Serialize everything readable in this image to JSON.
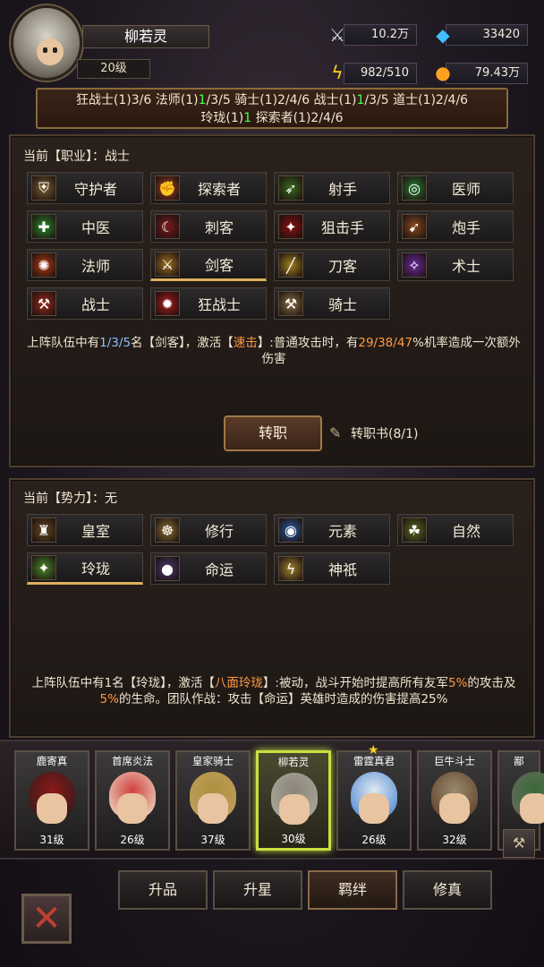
{
  "player": {
    "name": "柳若灵",
    "level": "20级"
  },
  "resources": {
    "power": "10.2万",
    "gems": "33420",
    "energy": "982/510",
    "gold": "79.43万"
  },
  "bonus": {
    "line1": [
      {
        "t": "狂战士(1)3/6 法师(1)"
      },
      {
        "t": "1",
        "g": true
      },
      {
        "t": "/3/5 骑士(1)2/4/6 战士(1)"
      },
      {
        "t": "1",
        "g": true
      },
      {
        "t": "/3/5 道士(1)2/4/6"
      }
    ],
    "line2": [
      {
        "t": "玲珑(1)"
      },
      {
        "t": "1",
        "g": true
      },
      {
        "t": " 探索者(1)2/4/6"
      }
    ]
  },
  "profession": {
    "header": "当前【职业】：战士",
    "items": [
      {
        "label": "守护者",
        "icon": "shield-icon",
        "color": "#7a6030",
        "glyph": "⛨"
      },
      {
        "label": "探索者",
        "icon": "fist-icon",
        "color": "#a04020",
        "glyph": "✊"
      },
      {
        "label": "射手",
        "icon": "arrow-icon",
        "color": "#3a6a20",
        "glyph": "➶"
      },
      {
        "label": "医师",
        "icon": "spiral-icon",
        "color": "#2a7a30",
        "glyph": "◎"
      },
      {
        "label": "中医",
        "icon": "cross-icon",
        "color": "#2a8a2a",
        "glyph": "✚"
      },
      {
        "label": "刺客",
        "icon": "blade-icon",
        "color": "#7a1a1a",
        "glyph": "☾"
      },
      {
        "label": "狙击手",
        "icon": "target-icon",
        "color": "#8a1010",
        "glyph": "✦"
      },
      {
        "label": "炮手",
        "icon": "cannon-icon",
        "color": "#8a4a20",
        "glyph": "➹"
      },
      {
        "label": "法师",
        "icon": "fire-icon",
        "color": "#b03a10",
        "glyph": "✺"
      },
      {
        "label": "剑客",
        "icon": "sword-icon",
        "color": "#a07020",
        "glyph": "⚔"
      },
      {
        "label": "刀客",
        "icon": "dagger-icon",
        "color": "#a08020",
        "glyph": "╱"
      },
      {
        "label": "术士",
        "icon": "magic-icon",
        "color": "#6a2a9a",
        "glyph": "✧"
      },
      {
        "label": "战士",
        "icon": "warrior-icon",
        "color": "#9a2a1a",
        "glyph": "⚒"
      },
      {
        "label": "狂战士",
        "icon": "rage-icon",
        "color": "#aa1a1a",
        "glyph": "✹"
      },
      {
        "label": "骑士",
        "icon": "hammer-icon",
        "color": "#8a7040",
        "glyph": "⚒"
      }
    ],
    "selected": 9,
    "desc_parts": [
      {
        "t": "上阵队伍中有"
      },
      {
        "t": "1/3/5",
        "c": "#8ac0ff"
      },
      {
        "t": "名【剑客】，激活【"
      },
      {
        "t": "速击",
        "c": "#ff9a40"
      },
      {
        "t": "】:普通攻击时，有"
      },
      {
        "t": "29/38/47",
        "c": "#ff9a40"
      },
      {
        "t": "%机率造成一次额外伤害"
      }
    ],
    "change_label": "转职",
    "book_label": "转职书(8/1)"
  },
  "faction": {
    "header": "当前【势力】：无",
    "items": [
      {
        "label": "皇室",
        "icon": "helmet-icon",
        "color": "#6a4a20",
        "glyph": "♜"
      },
      {
        "label": "修行",
        "icon": "meditate-icon",
        "color": "#8a7030",
        "glyph": "☸"
      },
      {
        "label": "元素",
        "icon": "vortex-icon",
        "color": "#2a5a9a",
        "glyph": "◉"
      },
      {
        "label": "自然",
        "icon": "nature-icon",
        "color": "#5a6a20",
        "glyph": "☘"
      },
      {
        "label": "玲珑",
        "icon": "sparkle-icon",
        "color": "#4a8a2a",
        "glyph": "✦"
      },
      {
        "label": "命运",
        "icon": "orb-icon",
        "color": "#4a3a6a",
        "glyph": "●"
      },
      {
        "label": "神祇",
        "icon": "lightning-icon",
        "color": "#a08030",
        "glyph": "ϟ"
      }
    ],
    "selected": 4,
    "desc_parts": [
      {
        "t": "上阵队伍中有1名【玲珑】，激活【"
      },
      {
        "t": "八面玲珑",
        "c": "#ff9a40"
      },
      {
        "t": "】:被动，战斗开始时提高所有友军"
      },
      {
        "t": "5%",
        "c": "#ff9a40"
      },
      {
        "t": "的攻击及"
      },
      {
        "t": "5%",
        "c": "#ff9a40"
      },
      {
        "t": "的生命。团队作战：攻击【命运】英雄时造成的伤害提高25%"
      }
    ]
  },
  "heroes": [
    {
      "name": "鹿寄真",
      "level": "31级",
      "hair": "#2a1a1a",
      "hat": "#8a1a1a"
    },
    {
      "name": "首席炎法",
      "level": "26级",
      "hair": "#f0e8d0",
      "hat": "#d04040"
    },
    {
      "name": "皇家骑士",
      "level": "37级",
      "hair": "#c0a060",
      "hat": "#b09040"
    },
    {
      "name": "柳若灵",
      "level": "30级",
      "hair": "#b0aca0",
      "hat": "#8a8478"
    },
    {
      "name": "雷霆真君",
      "level": "26级",
      "hair": "#4080d0",
      "hat": "#e0e8f0"
    },
    {
      "name": "巨牛斗士",
      "level": "32级",
      "hair": "#5a3a20",
      "hat": "#9a8a70"
    },
    {
      "name": "鄙",
      "level": "",
      "hair": "#6a6a60",
      "hat": "#3a6a3a"
    }
  ],
  "hero_selected": 3,
  "tabs": [
    "升品",
    "升星",
    "羁绊",
    "修真"
  ],
  "tab_selected": 2,
  "close_icon": "close-icon"
}
